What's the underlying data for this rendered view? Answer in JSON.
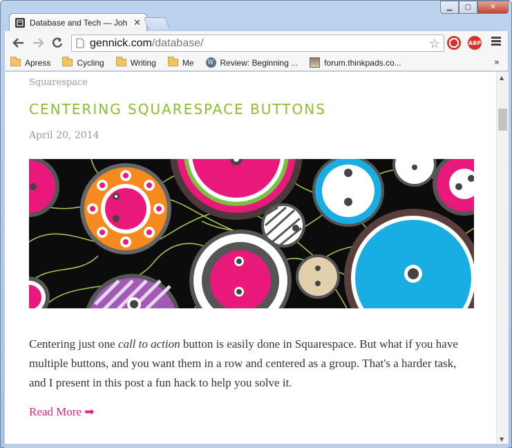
{
  "browser": {
    "tab_title": "Database and Tech — Joh",
    "url_host": "gennick.com",
    "url_path": "/database/",
    "extensions": [
      {
        "name": "stop-icon",
        "label": "",
        "color": "#d9302c"
      },
      {
        "name": "adblock-icon",
        "label": "ABP",
        "color": "#d9302c"
      }
    ]
  },
  "bookmarks": [
    {
      "label": "Apress",
      "icon": "folder-icon"
    },
    {
      "label": "Cycling",
      "icon": "folder-icon"
    },
    {
      "label": "Writing",
      "icon": "folder-icon"
    },
    {
      "label": "Me",
      "icon": "folder-icon"
    },
    {
      "label": "Review: Beginning ...",
      "icon": "wordpress-icon"
    },
    {
      "label": "forum.thinkpads.co...",
      "icon": "thumbnail-icon"
    }
  ],
  "post": {
    "category": "Squarespace",
    "title": "CENTERING SQUARESPACE BUTTONS",
    "date": "April 20, 2014",
    "excerpt_before": "Centering just one ",
    "excerpt_em": "call to action",
    "excerpt_after": " button is easily done in Squarespace. But what if you have multiple buttons, and you want them in a row and centered as a group. That's a harder task, and I present in this post a fun hack to help you solve it.",
    "read_more": "Read More ➡"
  },
  "colors": {
    "title_green": "#8bbd2e",
    "link_pink": "#e0227a",
    "meta_gray": "#999999"
  }
}
